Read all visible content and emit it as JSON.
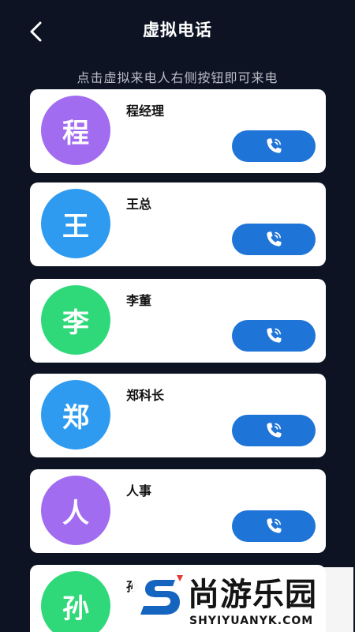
{
  "header": {
    "title": "虚拟电话",
    "back_icon": "chevron-left-icon"
  },
  "hint": "点击虚拟来电人右侧按钮即可来电",
  "contacts": [
    {
      "initial": "程",
      "name": "程经理",
      "color": "#a16cf0"
    },
    {
      "initial": "王",
      "name": "王总",
      "color": "#2e9bf0"
    },
    {
      "initial": "李",
      "name": "李董",
      "color": "#2fd97a"
    },
    {
      "initial": "郑",
      "name": "郑科长",
      "color": "#2e9bf0"
    },
    {
      "initial": "人",
      "name": "人事",
      "color": "#a16cf0"
    },
    {
      "initial": "孙",
      "name": "孙",
      "color": "#2fd97a"
    }
  ],
  "call_icon": "phone-call-icon",
  "watermark": {
    "brand": "尚游乐园",
    "url": "SHYIYUANYK.COM",
    "logo": "s-logo-icon"
  },
  "colors": {
    "background": "#0d1322",
    "button": "#1f74d8",
    "card": "#ffffff"
  }
}
